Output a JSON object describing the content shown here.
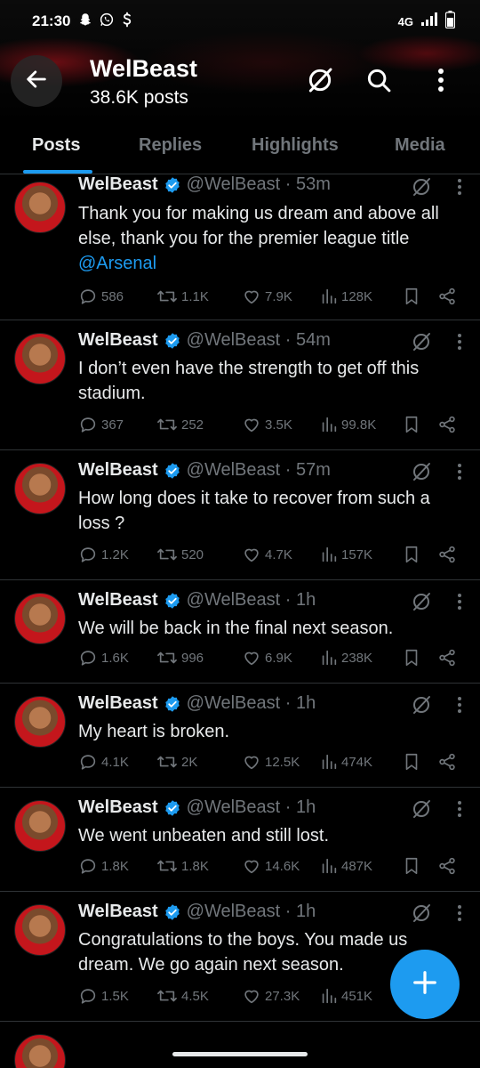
{
  "status_bar": {
    "time": "21:30",
    "network": "4G"
  },
  "profile": {
    "name": "WelBeast",
    "posts_count": "38.6K posts"
  },
  "tabs": [
    {
      "label": "Posts",
      "active": true
    },
    {
      "label": "Replies",
      "active": false
    },
    {
      "label": "Highlights",
      "active": false
    },
    {
      "label": "Media",
      "active": false
    }
  ],
  "tweets": [
    {
      "name": "WelBeast",
      "handle_time": "@WelBeast · 53m",
      "text": "Thank you for making us dream and above all else, thank you for the premier league title",
      "mention": "@Arsenal",
      "replies": "586",
      "reposts": "1.1K",
      "likes": "7.9K",
      "views": "128K"
    },
    {
      "name": "WelBeast",
      "handle_time": "@WelBeast · 54m",
      "text": "I don’t even have the strength to get off this stadium.",
      "replies": "367",
      "reposts": "252",
      "likes": "3.5K",
      "views": "99.8K"
    },
    {
      "name": "WelBeast",
      "handle_time": "@WelBeast · 57m",
      "text": "How long does it take to recover from such a loss ?",
      "replies": "1.2K",
      "reposts": "520",
      "likes": "4.7K",
      "views": "157K"
    },
    {
      "name": "WelBeast",
      "handle_time": "@WelBeast · 1h",
      "text": "We will be back in the final next season.",
      "replies": "1.6K",
      "reposts": "996",
      "likes": "6.9K",
      "views": "238K"
    },
    {
      "name": "WelBeast",
      "handle_time": "@WelBeast · 1h",
      "text": "My heart is broken.",
      "replies": "4.1K",
      "reposts": "2K",
      "likes": "12.5K",
      "views": "474K"
    },
    {
      "name": "WelBeast",
      "handle_time": "@WelBeast · 1h",
      "text": "We went unbeaten and still lost.",
      "replies": "1.8K",
      "reposts": "1.8K",
      "likes": "14.6K",
      "views": "487K"
    },
    {
      "name": "WelBeast",
      "handle_time": "@WelBeast · 1h",
      "text": "Congratulations to the boys. You made us dream. We go again next season.",
      "replies": "1.5K",
      "reposts": "4.5K",
      "likes": "27.3K",
      "views": "451K"
    }
  ],
  "colors": {
    "accent": "#1d9bf0",
    "muted": "#71767b",
    "background": "#000000",
    "divider": "#2f3336"
  }
}
